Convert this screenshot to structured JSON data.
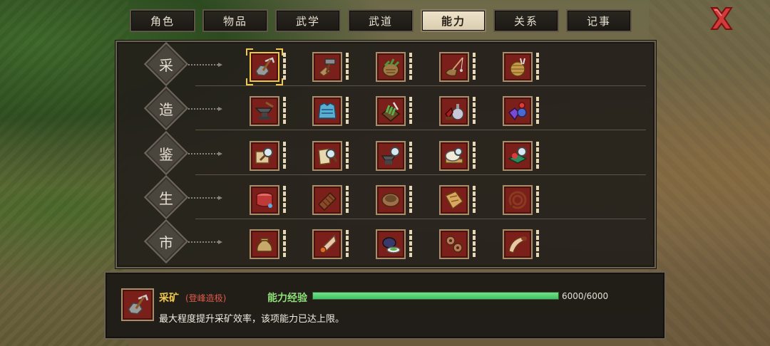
{
  "tabs": [
    {
      "label": "角色",
      "active": false
    },
    {
      "label": "物品",
      "active": false
    },
    {
      "label": "武学",
      "active": false
    },
    {
      "label": "武道",
      "active": false
    },
    {
      "label": "能力",
      "active": true
    },
    {
      "label": "关系",
      "active": false
    },
    {
      "label": "记事",
      "active": false
    }
  ],
  "categories": [
    {
      "label": "采",
      "skills": [
        "pickaxe-ore-icon",
        "hammer-axe-icon",
        "herb-basket-icon",
        "fishing-rod-icon",
        "yarn-spool-icon"
      ]
    },
    {
      "label": "造",
      "skills": [
        "anvil-icon",
        "armor-vest-icon",
        "herb-cutting-icon",
        "potion-icon",
        "gem-jewel-icon"
      ]
    },
    {
      "label": "鉴",
      "skills": [
        "scroll-magnifier-icon",
        "book-magnifier-icon",
        "anvil-magnifier-icon",
        "plate-magnifier-icon",
        "cloth-magnifier-icon"
      ]
    },
    {
      "label": "生",
      "skills": [
        "drum-cooking-icon",
        "chocolate-bar-icon",
        "bowl-icon",
        "map-sheet-icon",
        "coiled-whip-icon"
      ]
    },
    {
      "label": "市",
      "skills": [
        "money-bag-icon",
        "hand-coin-icon",
        "teapot-icon",
        "gear-cloth-icon",
        "horn-icon"
      ]
    }
  ],
  "selected": {
    "name": "采矿",
    "rank": "(登峰造极)",
    "exp_label": "能力经验",
    "exp_text": "6000/6000",
    "exp_fraction": 1.0,
    "description": "最大程度提升采矿效率，该项能力已达上限。"
  },
  "colors": {
    "slot_bg": "#7a1f1a",
    "slot_border": "#a68e6a",
    "highlight": "#f3c84d",
    "exp_green": "#3ec164",
    "close_red": "#d33a3a"
  }
}
